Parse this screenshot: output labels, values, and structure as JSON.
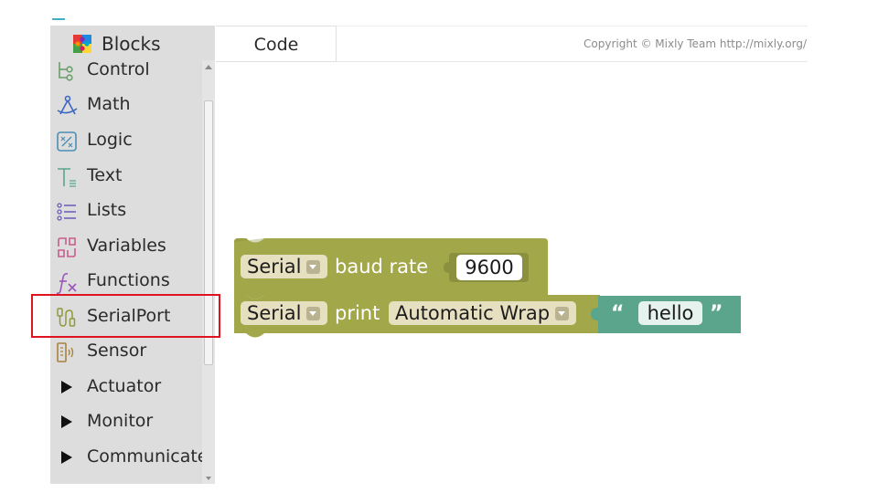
{
  "toolbox": {
    "tab_label": "Blocks",
    "tab_icon": "puzzle-icon",
    "categories": [
      {
        "label": "Control",
        "icon": "control-flow-icon"
      },
      {
        "label": "Math",
        "icon": "compass-icon"
      },
      {
        "label": "Logic",
        "icon": "logic-icon"
      },
      {
        "label": "Text",
        "icon": "text-icon"
      },
      {
        "label": "Lists",
        "icon": "list-icon"
      },
      {
        "label": "Variables",
        "icon": "variables-icon"
      },
      {
        "label": "Functions",
        "icon": "function-icon"
      },
      {
        "label": "SerialPort",
        "icon": "serial-port-icon"
      },
      {
        "label": "Sensor",
        "icon": "sensor-icon"
      },
      {
        "label": "Actuator",
        "icon": "triangle-right-icon"
      },
      {
        "label": "Monitor",
        "icon": "triangle-right-icon"
      },
      {
        "label": "Communicate",
        "icon": "triangle-right-icon"
      }
    ],
    "highlighted": "SerialPort"
  },
  "header": {
    "code_tab_label": "Code",
    "copyright": "Copyright © Mixly Team http://mixly.org/"
  },
  "workspace": {
    "block_begin": {
      "dropdown_value": "Serial",
      "label": "baud rate",
      "value": "9600"
    },
    "block_print": {
      "dropdown_value": "Serial",
      "label": "print",
      "mode_value": "Automatic Wrap",
      "open_quote": "“",
      "string_value": "hello",
      "close_quote": "”"
    }
  },
  "colors": {
    "serial_block": "#a2a849",
    "text_block": "#5ba58c",
    "highlight": "#e0141e",
    "sidebar": "#dddddd"
  }
}
